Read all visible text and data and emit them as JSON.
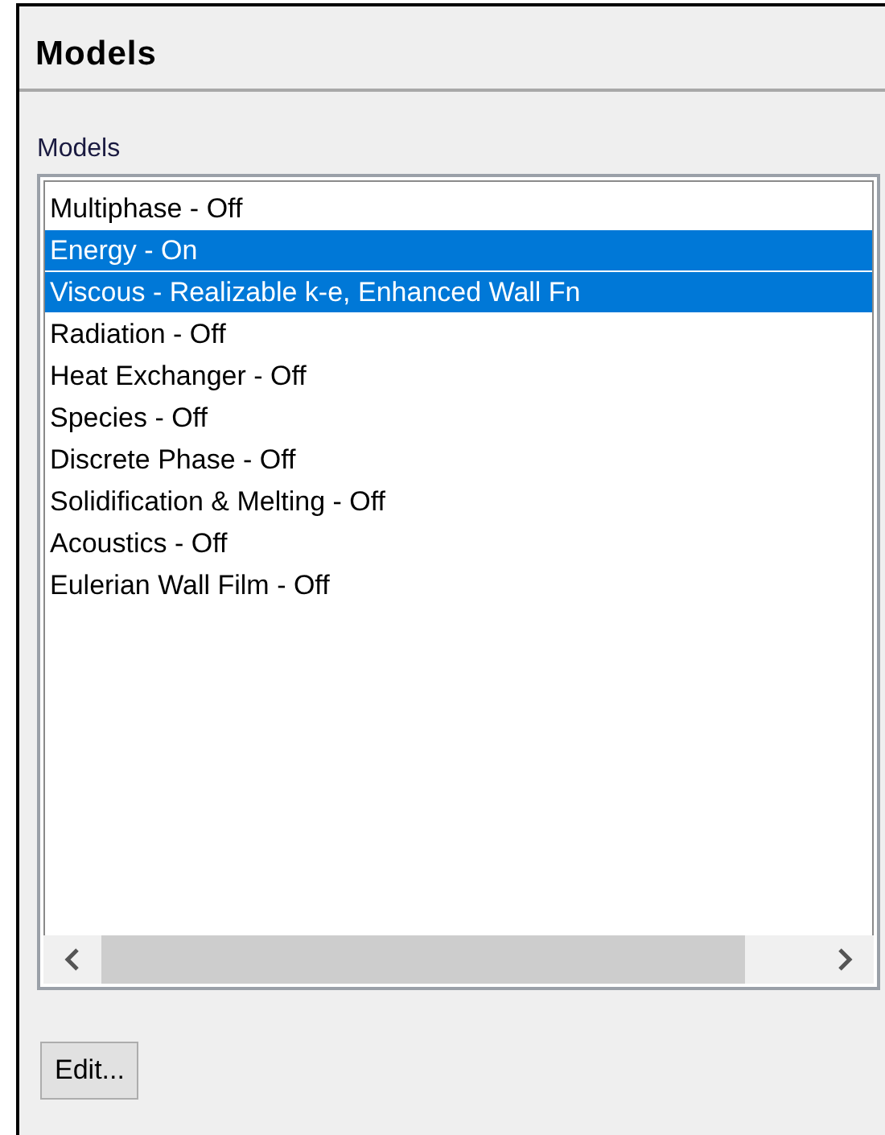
{
  "panel": {
    "title": "Models"
  },
  "list": {
    "label": "Models",
    "items": [
      {
        "label": "Multiphase - Off",
        "selected": false
      },
      {
        "label": "Energy - On",
        "selected": true
      },
      {
        "label": "Viscous - Realizable k-e, Enhanced Wall Fn",
        "selected": true
      },
      {
        "label": "Radiation - Off",
        "selected": false
      },
      {
        "label": "Heat Exchanger - Off",
        "selected": false
      },
      {
        "label": "Species - Off",
        "selected": false
      },
      {
        "label": "Discrete Phase - Off",
        "selected": false
      },
      {
        "label": "Solidification & Melting - Off",
        "selected": false
      },
      {
        "label": "Acoustics - Off",
        "selected": false
      },
      {
        "label": "Eulerian Wall Film - Off",
        "selected": false
      }
    ]
  },
  "buttons": [
    "Edit..."
  ]
}
